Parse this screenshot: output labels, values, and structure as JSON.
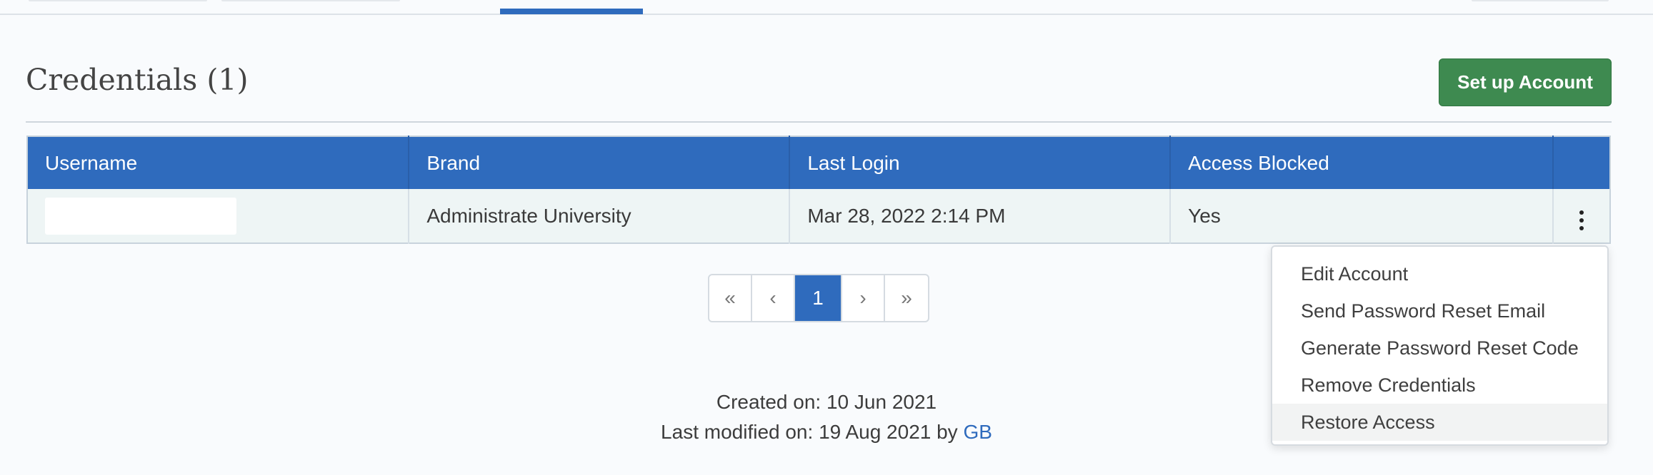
{
  "section": {
    "title": "Credentials (1)",
    "setup_button_label": "Set up Account"
  },
  "table": {
    "columns": [
      "Username",
      "Brand",
      "Last Login",
      "Access Blocked"
    ],
    "rows": [
      {
        "username": "",
        "brand": "Administrate University",
        "last_login": "Mar 28, 2022 2:14 PM",
        "access_blocked": "Yes"
      }
    ]
  },
  "pagination": {
    "first": "«",
    "prev": "‹",
    "current": "1",
    "next": "›",
    "last": "»"
  },
  "actions_menu": {
    "items": [
      "Edit Account",
      "Send Password Reset Email",
      "Generate Password Reset Code",
      "Remove Credentials",
      "Restore Access"
    ]
  },
  "meta": {
    "created_label": "Created on: 10 Jun 2021",
    "modified_label": "Last modified on: 19 Aug 2021 by",
    "modified_by": "GB"
  },
  "colors": {
    "header_blue": "#2f6bbd",
    "button_green": "#3e8a50"
  }
}
